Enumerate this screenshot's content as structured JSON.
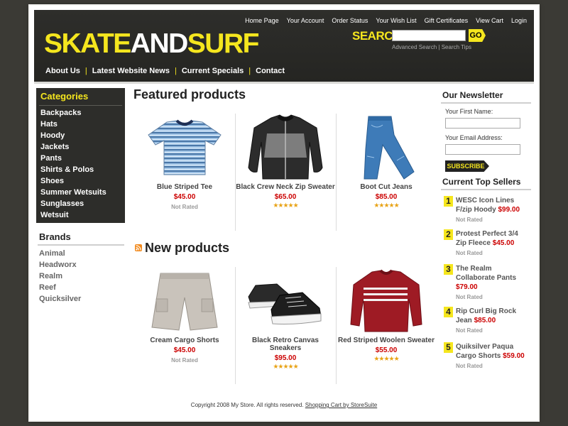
{
  "header": {
    "top_links": [
      "Home Page",
      "Your Account",
      "Order Status",
      "Your Wish List",
      "Gift Certificates",
      "View Cart",
      "Login"
    ],
    "logo_part1": "SKATE",
    "logo_part2": "AND",
    "logo_part3": "SURF",
    "search_label": "SEARCH",
    "search_placeholder": "",
    "go_label": "GO",
    "advanced_search": "Advanced Search",
    "search_tips": "Search Tips",
    "nav": [
      "About Us",
      "Latest Website News",
      "Current Specials",
      "Contact"
    ]
  },
  "categories": {
    "title": "Categories",
    "items": [
      "Backpacks",
      "Hats",
      "Hoody",
      "Jackets",
      "Pants",
      "Shirts & Polos",
      "Shoes",
      "Summer Wetsuits",
      "Sunglasses",
      "Wetsuit"
    ]
  },
  "brands": {
    "title": "Brands",
    "items": [
      "Animal",
      "Headworx",
      "Realm",
      "Reef",
      "Quicksilver"
    ]
  },
  "featured": {
    "title": "Featured products",
    "products": [
      {
        "name": "Blue Striped Tee",
        "price": "$45.00",
        "rating": "Not Rated",
        "stars": null,
        "icon": "tshirt-icon"
      },
      {
        "name": "Black Crew Neck Zip Sweater",
        "price": "$65.00",
        "rating": null,
        "stars": 5,
        "icon": "jacket-icon"
      },
      {
        "name": "Boot Cut Jeans",
        "price": "$85.00",
        "rating": null,
        "stars": 5,
        "icon": "jeans-icon"
      }
    ]
  },
  "new_products": {
    "title": "New products",
    "products": [
      {
        "name": "Cream Cargo Shorts",
        "price": "$45.00",
        "rating": "Not Rated",
        "stars": null,
        "icon": "shorts-icon"
      },
      {
        "name": "Black Retro Canvas Sneakers",
        "price": "$95.00",
        "rating": null,
        "stars": 5,
        "icon": "sneakers-icon"
      },
      {
        "name": "Red Striped Woolen Sweater",
        "price": "$55.00",
        "rating": null,
        "stars": 5,
        "icon": "sweater-icon"
      }
    ]
  },
  "newsletter": {
    "title": "Our Newsletter",
    "first_name_label": "Your First Name:",
    "email_label": "Your Email Address:",
    "subscribe_label": "SUBSCRIBE"
  },
  "top_sellers": {
    "title": "Current Top Sellers",
    "items": [
      {
        "rank": "1",
        "name": "WESC Icon Lines F/zip Hoody",
        "price": "$99.00",
        "rating": "Not Rated"
      },
      {
        "rank": "2",
        "name": "Protest Perfect 3/4 Zip Fleece",
        "price": "$45.00",
        "rating": "Not Rated"
      },
      {
        "rank": "3",
        "name": "The Realm Collaborate Pants",
        "price": "$79.00",
        "rating": "Not Rated"
      },
      {
        "rank": "4",
        "name": "Rip Curl Big Rock Jean",
        "price": "$85.00",
        "rating": "Not Rated"
      },
      {
        "rank": "5",
        "name": "Quiksilver Paqua Cargo Shorts",
        "price": "$59.00",
        "rating": "Not Rated"
      }
    ]
  },
  "footer": {
    "copyright": "Copyright 2008 My Store. All rights reserved.",
    "link": "Shopping Cart by StoreSuite"
  },
  "colors": {
    "accent": "#f5e61e",
    "price": "#cc0000",
    "header_bg": "#2d2d2a"
  }
}
